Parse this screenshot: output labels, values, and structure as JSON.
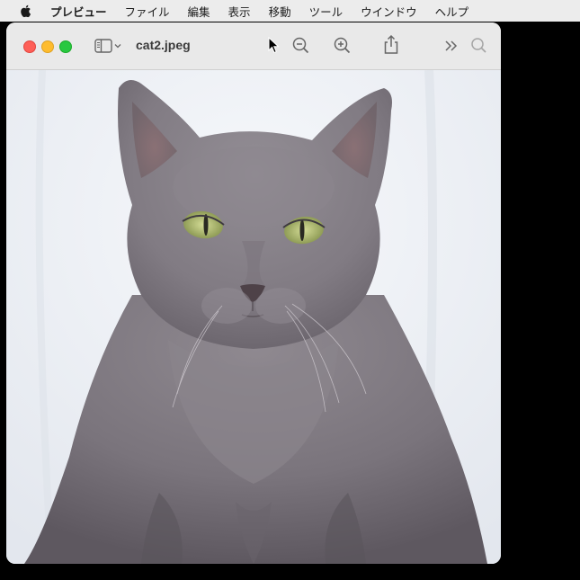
{
  "menubar": {
    "apple_icon": "apple-logo-icon",
    "app_name": "プレビュー",
    "items": [
      "ファイル",
      "編集",
      "表示",
      "移動",
      "ツール",
      "ウインドウ",
      "ヘルプ"
    ]
  },
  "window": {
    "title": "cat2.jpeg",
    "toolbar": {
      "sidebar_icon": "sidebar-icon",
      "zoom_out_icon": "zoom-out-icon",
      "zoom_in_icon": "zoom-in-icon",
      "share_icon": "share-icon",
      "more_icon": "chevron-double-right-icon",
      "search_icon": "search-icon"
    },
    "image": {
      "description_icon": "cat-photo",
      "background_color": "#eef1f5",
      "fur_color": "#858088",
      "eye_color": "#b9c57a"
    }
  },
  "colors": {
    "close": "#fe5f57",
    "minimize": "#febc2e",
    "maximize": "#28c840"
  }
}
